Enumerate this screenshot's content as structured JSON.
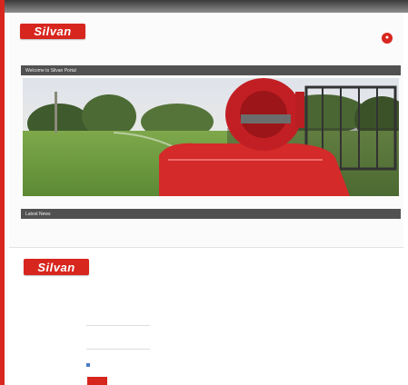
{
  "colors": {
    "brand_red": "#d7261e",
    "section_bar": "#515151",
    "top_bar_dark": "#3a3a3a"
  },
  "panel1": {
    "util_links": [
      "",
      "",
      ""
    ],
    "logo_text": "Silvan",
    "nav": [
      "",
      "",
      "",
      "",
      ""
    ],
    "cart_icon": "shopping-cart-icon",
    "welcome_title": "Welcome to Silvan Portal",
    "hero_image": "spray-tank-in-field-photo",
    "latest_news_title": "Latest News",
    "news_lines": [
      "",
      ""
    ]
  },
  "panel2": {
    "util_links": [
      "",
      ""
    ],
    "logo_text": "Silvan",
    "nav": [
      "",
      "",
      "",
      "",
      ""
    ],
    "login_title": "",
    "username_label": "",
    "username_value": "",
    "password_label": "",
    "remember_label": "",
    "forgot_label": "",
    "login_button": "",
    "help_lines": [
      "",
      "",
      ""
    ]
  }
}
